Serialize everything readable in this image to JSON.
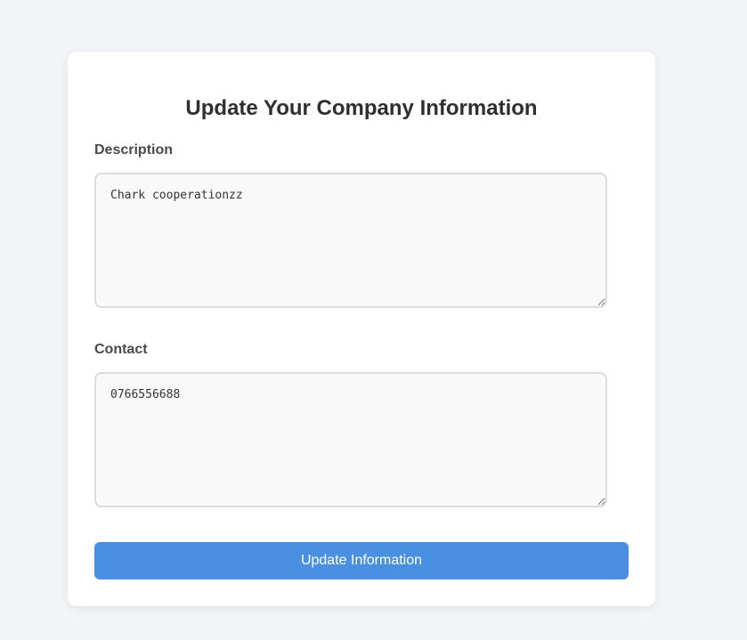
{
  "form": {
    "title": "Update Your Company Information",
    "description": {
      "label": "Description",
      "value": "Chark cooperationzz"
    },
    "contact": {
      "label": "Contact",
      "value": "0766556688"
    },
    "submit_label": "Update Information"
  },
  "colors": {
    "page_background": "#f3f4f8",
    "card_background": "#ffffff",
    "button_background": "#4a90e2",
    "field_border": "#dcdcdc"
  }
}
